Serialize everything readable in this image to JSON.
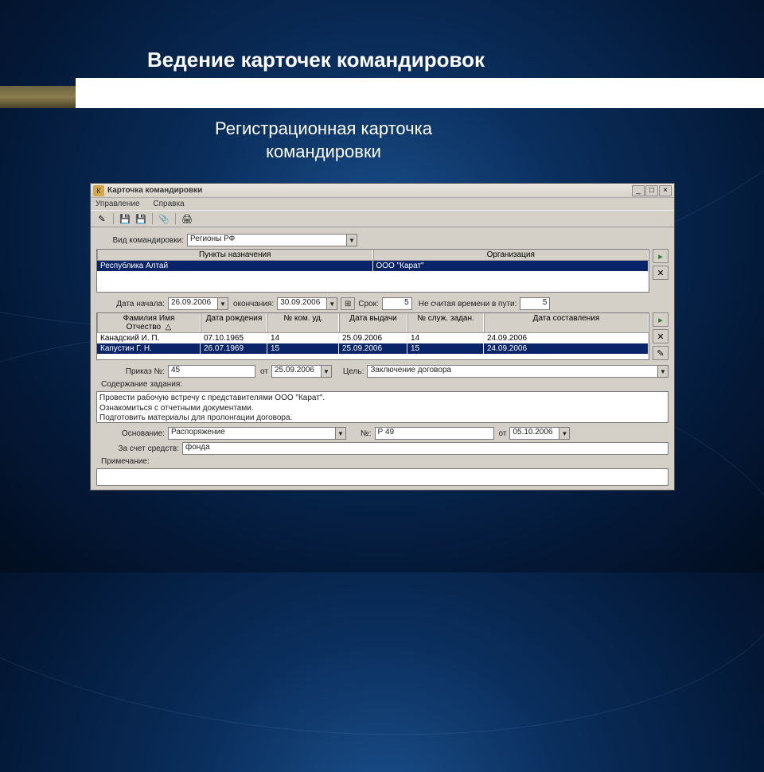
{
  "slide": {
    "title": "Ведение карточек командировок",
    "subtitle_l1": "Регистрационная карточка",
    "subtitle_l2": "командировки"
  },
  "window": {
    "title": "Карточка командировки",
    "menu": {
      "manage": "Управление",
      "help": "Справка"
    },
    "labels": {
      "trip_type": "Вид командировки:",
      "dest_header": "Пункты назначения",
      "org_header": "Организация",
      "start_date": "Дата начала:",
      "end_date": "окончания:",
      "duration": "Срок:",
      "excl_travel": "Не считая времени в пути:",
      "col_fio": "Фамилия Имя Отчество",
      "col_dob": "Дата рождения",
      "col_komud": "№ ком. уд.",
      "col_issue": "Дата выдачи",
      "col_sluz": "№ служ. задан.",
      "col_compiled": "Дата составления",
      "order_no": "Приказ №:",
      "order_from": "от",
      "purpose": "Цель:",
      "task_content": "Содержание задания:",
      "basis": "Основание:",
      "basis_no": "№:",
      "basis_from": "от",
      "funds": "За счет средств:",
      "note": "Примечание:"
    },
    "values": {
      "trip_type": "Регионы РФ",
      "start_date": "26.09.2006",
      "end_date": "30.09.2006",
      "duration": "5",
      "excl_travel": "5",
      "order_no": "45",
      "order_date": "25.09.2006",
      "purpose": "Заключение договора",
      "task_l1": "Провести рабочую встречу с представителями ООО \"Карат\".",
      "task_l2": "Ознакомиться с отчетными документами.",
      "task_l3": "Подготовить материалы для пролонгации договора.",
      "basis": "Распоряжение",
      "basis_no": "Р 49",
      "basis_date": "05.10.2006",
      "funds": "фонда",
      "note": ""
    },
    "destinations": [
      {
        "place": "Республика Алтай",
        "org": "ООО \"Карат\""
      }
    ],
    "people": [
      {
        "fio": "Канадский И. П.",
        "dob": "07.10.1965",
        "komud": "14",
        "issue": "25.09.2006",
        "sluz": "14",
        "compiled": "24.09.2006"
      },
      {
        "fio": "Капустин Г. Н.",
        "dob": "26.07.1969",
        "komud": "15",
        "issue": "25.09.2006",
        "sluz": "15",
        "compiled": "24.09.2006"
      }
    ]
  }
}
